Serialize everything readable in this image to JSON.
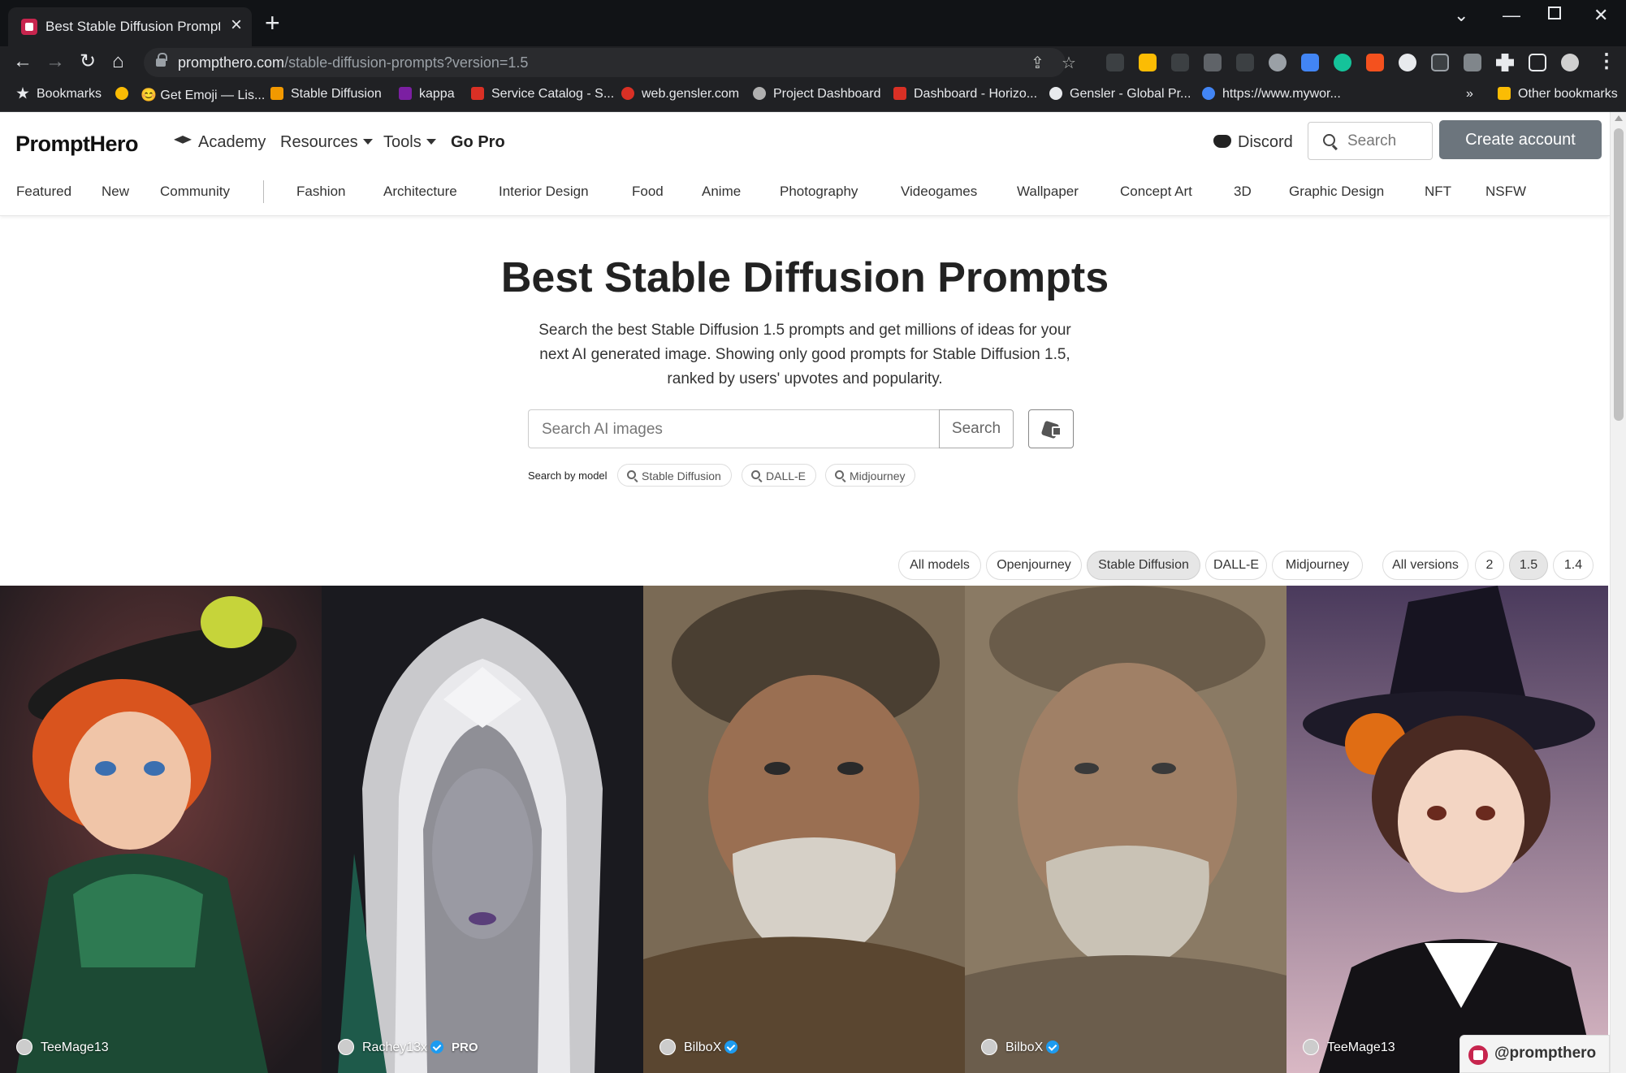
{
  "browser": {
    "tab_title": "Best Stable Diffusion Prompts - P",
    "url_host": "prompthero.com",
    "url_path": "/stable-diffusion-prompts?version=1.5",
    "bookmarks": [
      {
        "label": "Bookmarks",
        "color": "#e8eaed"
      },
      {
        "label": "",
        "color": "#fbbc04"
      },
      {
        "label": "😊 Get Emoji — Lis...",
        "color": "#fbbc04"
      },
      {
        "label": "Stable Diffusion",
        "color": "#f29900"
      },
      {
        "label": "kappa",
        "color": "#7b1fa2"
      },
      {
        "label": "Service Catalog - S...",
        "color": "#d93025"
      },
      {
        "label": "web.gensler.com",
        "color": "#d93025"
      },
      {
        "label": "Project Dashboard",
        "color": "#b0b0b0"
      },
      {
        "label": "Dashboard - Horizo...",
        "color": "#d93025"
      },
      {
        "label": "Gensler - Global Pr...",
        "color": "#e8eaed"
      },
      {
        "label": "https://www.mywor...",
        "color": "#4285f4"
      }
    ],
    "more_bookmarks": "»",
    "other_bookmarks": "Other bookmarks"
  },
  "site": {
    "logo": "PromptHero",
    "nav": {
      "academy": "Academy",
      "resources": "Resources",
      "tools": "Tools",
      "go_pro": "Go Pro",
      "discord": "Discord",
      "search_placeholder": "Search",
      "create_account": "Create account"
    },
    "categories": [
      "Featured",
      "New",
      "Community",
      "Fashion",
      "Architecture",
      "Interior Design",
      "Food",
      "Anime",
      "Photography",
      "Videogames",
      "Wallpaper",
      "Concept Art",
      "3D",
      "Graphic Design",
      "NFT",
      "NSFW"
    ],
    "hero": {
      "title": "Best Stable Diffusion Prompts",
      "description": "Search the best Stable Diffusion 1.5 prompts and get millions of ideas for your next AI generated image. Showing only good prompts for Stable Diffusion 1.5, ranked by users' upvotes and popularity.",
      "search_placeholder": "Search AI images",
      "search_button": "Search",
      "search_by_model": "Search by model",
      "models": [
        "Stable Diffusion",
        "DALL-E",
        "Midjourney"
      ]
    },
    "model_filters": [
      {
        "label": "All models",
        "active": false
      },
      {
        "label": "Openjourney",
        "active": false
      },
      {
        "label": "Stable Diffusion",
        "active": true
      },
      {
        "label": "DALL-E",
        "active": false
      },
      {
        "label": "Midjourney",
        "active": false
      }
    ],
    "version_filters": [
      {
        "label": "All versions",
        "active": false
      },
      {
        "label": "2",
        "active": false
      },
      {
        "label": "1.5",
        "active": true
      },
      {
        "label": "1.4",
        "active": false
      }
    ],
    "cards": [
      {
        "user": "TeeMage13",
        "verified": false,
        "pro": ""
      },
      {
        "user": "Rachey13x",
        "verified": true,
        "pro": "PRO"
      },
      {
        "user": "BilboX",
        "verified": true,
        "pro": ""
      },
      {
        "user": "BilboX",
        "verified": true,
        "pro": ""
      },
      {
        "user": "TeeMage13",
        "verified": false,
        "pro": ""
      }
    ],
    "handle": "@prompthero"
  },
  "colors": {
    "create_account_bg": "#6c757d",
    "brand": "#c7254e",
    "verified": "#1d9bf0"
  }
}
